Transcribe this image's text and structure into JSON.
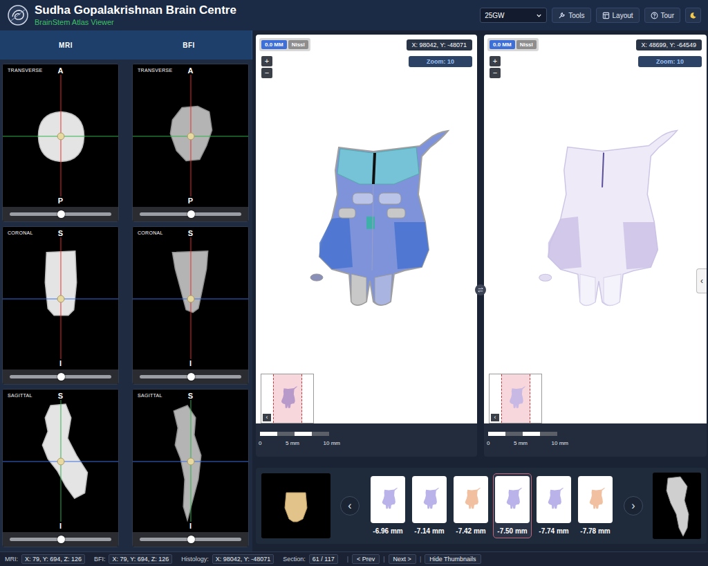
{
  "header": {
    "title": "Sudha Gopalakrishnan Brain Centre",
    "subtitle": "BrainStem Atlas Viewer",
    "dataset": "25GW",
    "buttons": [
      {
        "label": "Tools",
        "kind": "tools"
      },
      {
        "label": "Layout",
        "kind": "layout"
      },
      {
        "label": "Tour",
        "kind": "tour"
      }
    ]
  },
  "left_panel": {
    "columns": [
      {
        "label": "MRI",
        "kind": "mri",
        "views": [
          {
            "label": "TRANSVERSE",
            "kind": "transverse",
            "top": "A",
            "bottom": "P",
            "level": 0.5
          },
          {
            "label": "CORONAL",
            "kind": "coronal",
            "top": "S",
            "bottom": "I",
            "level": 0.5
          },
          {
            "label": "SAGITTAL",
            "kind": "sagittal",
            "top": "S",
            "bottom": "I",
            "level": 0.5
          }
        ]
      },
      {
        "label": "BFI",
        "kind": "bfi",
        "views": [
          {
            "label": "TRANSVERSE",
            "kind": "transverse",
            "top": "A",
            "bottom": "P",
            "level": 0.5
          },
          {
            "label": "CORONAL",
            "kind": "coronal",
            "top": "S",
            "bottom": "I",
            "level": 0.5
          },
          {
            "label": "SAGITTAL",
            "kind": "sagittal",
            "top": "S",
            "bottom": "I",
            "level": 0.5
          }
        ]
      }
    ]
  },
  "histology_panels": [
    {
      "kind": "annotated",
      "depth": "0.0 MM",
      "stain": "Nissl",
      "coords": "X: 98042, Y: -48071",
      "zoom": "Zoom: 10",
      "zoom_in": "+",
      "zoom_out": "−",
      "minimap_toggle": "‹",
      "scale": [
        "0",
        "5 mm",
        "10 mm"
      ]
    },
    {
      "kind": "nissl",
      "depth": "0.0 MM",
      "stain": "Nissl",
      "coords": "X: 48699, Y: -64549",
      "zoom": "Zoom: 10",
      "zoom_in": "+",
      "zoom_out": "−",
      "minimap_toggle": "‹",
      "scale": [
        "0",
        "5 mm",
        "10 mm"
      ],
      "side_toggle": "‹"
    }
  ],
  "thumbnails": {
    "prev": "‹",
    "next": "›",
    "items": [
      {
        "label": "-6.96 mm",
        "selected": false,
        "color": "#b9b3ea"
      },
      {
        "label": "-7.14 mm",
        "selected": false,
        "color": "#b9b3ea"
      },
      {
        "label": "-7.42 mm",
        "selected": false,
        "color": "#f0c0a0"
      },
      {
        "label": "-7.50 mm",
        "selected": true,
        "color": "#b9b3ea"
      },
      {
        "label": "-7.74 mm",
        "selected": false,
        "color": "#b9b3ea"
      },
      {
        "label": "-7.78 mm",
        "selected": false,
        "color": "#f0c0a0"
      }
    ]
  },
  "status_bar": {
    "fields": [
      {
        "label": "MRI:",
        "value": "X: 79, Y: 694, Z: 126"
      },
      {
        "label": "BFI:",
        "value": "X: 79, Y: 694, Z: 126"
      },
      {
        "label": "Histology:",
        "value": "X: 98042, Y: -48071"
      },
      {
        "label": "Section:",
        "value": "61 / 117"
      }
    ],
    "separator": "|",
    "buttons": [
      "< Prev",
      "Next >",
      "Hide Thumbnails"
    ]
  }
}
